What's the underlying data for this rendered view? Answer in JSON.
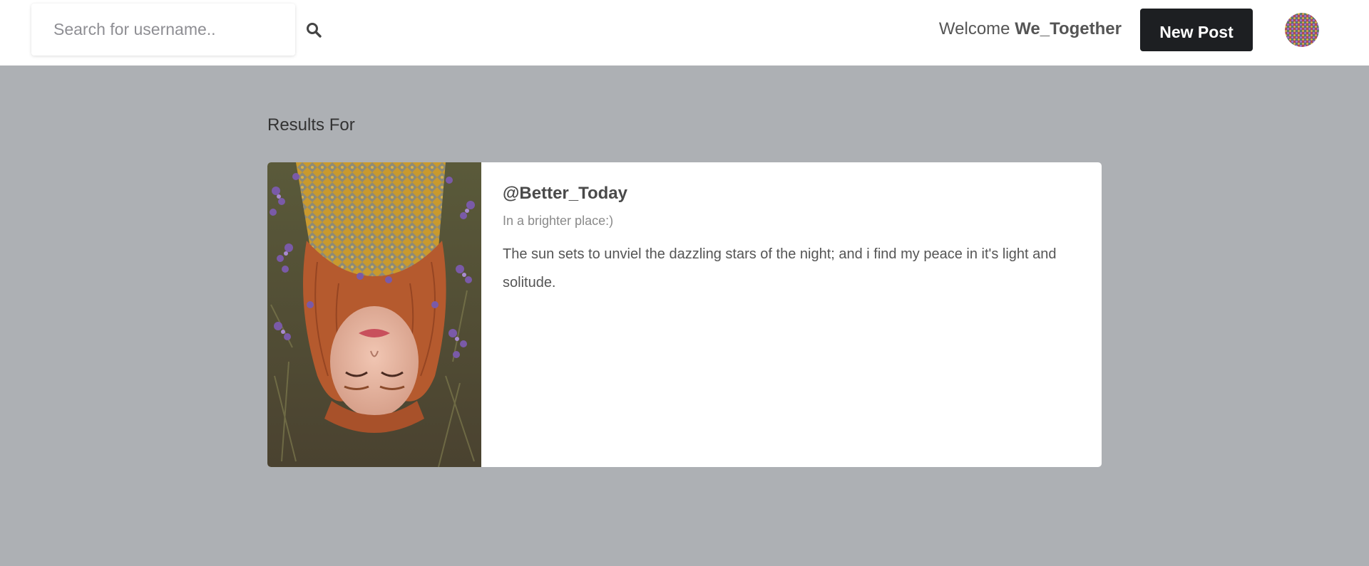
{
  "header": {
    "search": {
      "placeholder": "Search for username..",
      "value": "",
      "icon": "search-icon"
    },
    "welcome_prefix": "Welcome",
    "username": "We_Together",
    "new_post_label": "New Post",
    "avatar_icon": "user-avatar"
  },
  "main": {
    "heading": "Results For",
    "results": [
      {
        "username": "@Better_Today",
        "subtitle": "In a brighter place:)",
        "text": "The sun sets to unviel the dazzling stars of the night; and i find my peace in it's light and solitude."
      }
    ]
  },
  "colors": {
    "page_background": "#adb0b4",
    "header_background": "#ffffff",
    "button_background": "#1d1f22",
    "button_text": "#ffffff"
  }
}
